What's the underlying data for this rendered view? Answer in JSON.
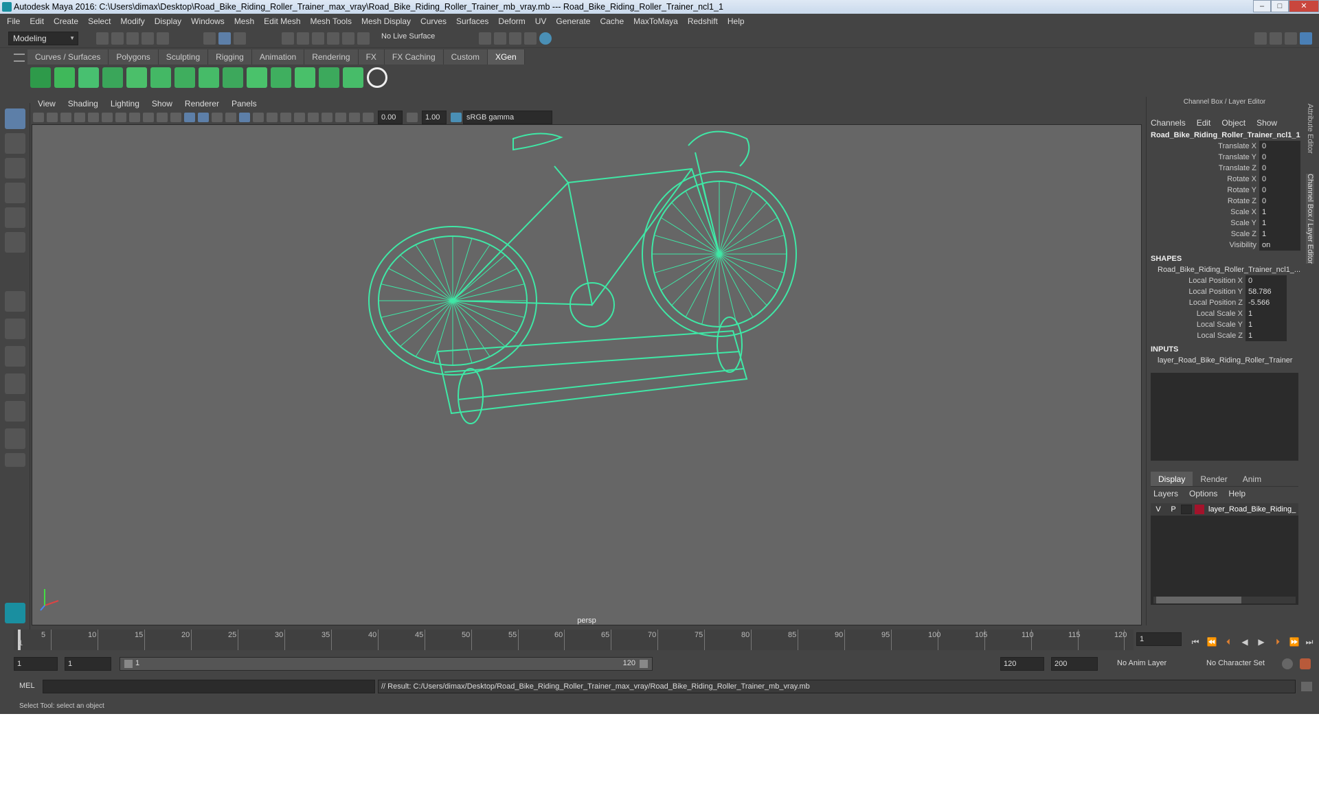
{
  "window": {
    "title": "Autodesk Maya 2016: C:\\Users\\dimax\\Desktop\\Road_Bike_Riding_Roller_Trainer_max_vray\\Road_Bike_Riding_Roller_Trainer_mb_vray.mb   ---   Road_Bike_Riding_Roller_Trainer_ncl1_1"
  },
  "menubar": [
    "File",
    "Edit",
    "Create",
    "Select",
    "Modify",
    "Display",
    "Windows",
    "Mesh",
    "Edit Mesh",
    "Mesh Tools",
    "Mesh Display",
    "Curves",
    "Surfaces",
    "Deform",
    "UV",
    "Generate",
    "Cache",
    "MaxToMaya",
    "Redshift",
    "Help"
  ],
  "statusline": {
    "mode": "Modeling",
    "live_surface": "No Live Surface"
  },
  "shelf_tabs": [
    "Curves / Surfaces",
    "Polygons",
    "Sculpting",
    "Rigging",
    "Animation",
    "Rendering",
    "FX",
    "FX Caching",
    "Custom",
    "XGen"
  ],
  "active_shelf": "XGen",
  "shelf_icons": [
    "xgen-x-icon",
    "xgen-eye-icon",
    "xgen-leaf-icon",
    "xgen-guide-icon",
    "xgen-comb-icon",
    "xgen-add-guide-icon",
    "xgen-sculpt-icon",
    "xgen-lock-icon",
    "xgen-groom-icon",
    "xgen-layers-icon",
    "xgen-cut-icon",
    "xgen-brush-icon",
    "xgen-length-icon",
    "xgen-noise-icon",
    "xgen-hex-icon"
  ],
  "viewport": {
    "menu": [
      "View",
      "Shading",
      "Lighting",
      "Show",
      "Renderer",
      "Panels"
    ],
    "exposure": "0.00",
    "gamma": "1.00",
    "color_space": "sRGB gamma",
    "camera": "persp",
    "wire_color": "#3fe8a6"
  },
  "channel_box": {
    "header": "Channel Box / Layer Editor",
    "menu": [
      "Channels",
      "Edit",
      "Object",
      "Show"
    ],
    "object_name": "Road_Bike_Riding_Roller_Trainer_ncl1_1",
    "attributes": [
      {
        "label": "Translate X",
        "value": "0"
      },
      {
        "label": "Translate Y",
        "value": "0"
      },
      {
        "label": "Translate Z",
        "value": "0"
      },
      {
        "label": "Rotate X",
        "value": "0"
      },
      {
        "label": "Rotate Y",
        "value": "0"
      },
      {
        "label": "Rotate Z",
        "value": "0"
      },
      {
        "label": "Scale X",
        "value": "1"
      },
      {
        "label": "Scale Y",
        "value": "1"
      },
      {
        "label": "Scale Z",
        "value": "1"
      },
      {
        "label": "Visibility",
        "value": "on"
      }
    ],
    "shapes_label": "SHAPES",
    "shape_name": "Road_Bike_Riding_Roller_Trainer_ncl1_...",
    "shape_attributes": [
      {
        "label": "Local Position X",
        "value": "0"
      },
      {
        "label": "Local Position Y",
        "value": "58.786"
      },
      {
        "label": "Local Position Z",
        "value": "-5.566"
      },
      {
        "label": "Local Scale X",
        "value": "1"
      },
      {
        "label": "Local Scale Y",
        "value": "1"
      },
      {
        "label": "Local Scale Z",
        "value": "1"
      }
    ],
    "inputs_label": "INPUTS",
    "input_name": "layer_Road_Bike_Riding_Roller_Trainer"
  },
  "layer_editor": {
    "tabs": [
      "Display",
      "Render",
      "Anim"
    ],
    "menu": [
      "Layers",
      "Options",
      "Help"
    ],
    "layer": {
      "v": "V",
      "p": "P",
      "name": "layer_Road_Bike_Riding_",
      "color": "#a3132b"
    }
  },
  "side_tabs": [
    "Attribute Editor",
    "Channel Box / Layer Editor"
  ],
  "timeline": {
    "ticks": [
      "5",
      "10",
      "15",
      "20",
      "25",
      "30",
      "35",
      "40",
      "45",
      "50",
      "55",
      "60",
      "65",
      "70",
      "75",
      "80",
      "85",
      "90",
      "95",
      "100",
      "105",
      "110",
      "115",
      "120"
    ],
    "current_frame_marker": "1",
    "current_frame": "1"
  },
  "range": {
    "start": "1",
    "start2": "1",
    "range_start": "1",
    "range_end": "120",
    "end": "120",
    "end2": "200",
    "anim_layer": "No Anim Layer",
    "char_set": "No Character Set"
  },
  "command": {
    "lang": "MEL",
    "result": "// Result: C:/Users/dimax/Desktop/Road_Bike_Riding_Roller_Trainer_max_vray/Road_Bike_Riding_Roller_Trainer_mb_vray.mb"
  },
  "help_line": "Select Tool: select an object"
}
